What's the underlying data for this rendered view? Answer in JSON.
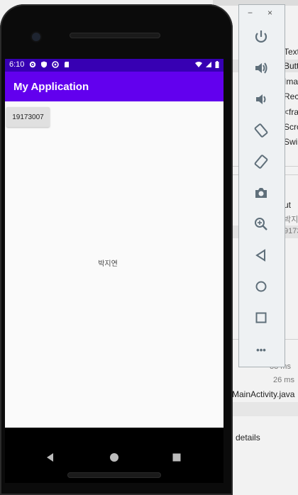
{
  "device": {
    "status_time": "6:10",
    "app_title": "My Application",
    "button_label": "19173007",
    "center_text": "박지연"
  },
  "ide_background": {
    "palette_items": [
      "Text",
      "Butt",
      "Ima",
      "Rec",
      "<fra",
      "Scro",
      "Swi"
    ],
    "tree_items": [
      "ut",
      "박지",
      "9173"
    ],
    "log_times": [
      "88 ms",
      "26 ms"
    ],
    "file_name": "MainActivity.java",
    "footer_text": "details"
  },
  "emulator_toolbar": {
    "minimize_label": "−",
    "close_label": "×",
    "more_label": "•••",
    "buttons": [
      "power-icon",
      "volume-up-icon",
      "volume-down-icon",
      "rotate-left-icon",
      "rotate-right-icon",
      "camera-icon",
      "zoom-icon",
      "back-icon",
      "home-icon",
      "overview-icon",
      "more-icon"
    ]
  },
  "colors": {
    "status_bar": "#3700b3",
    "app_bar": "#6200ee",
    "toolbar_icon": "#5f6f7a"
  }
}
